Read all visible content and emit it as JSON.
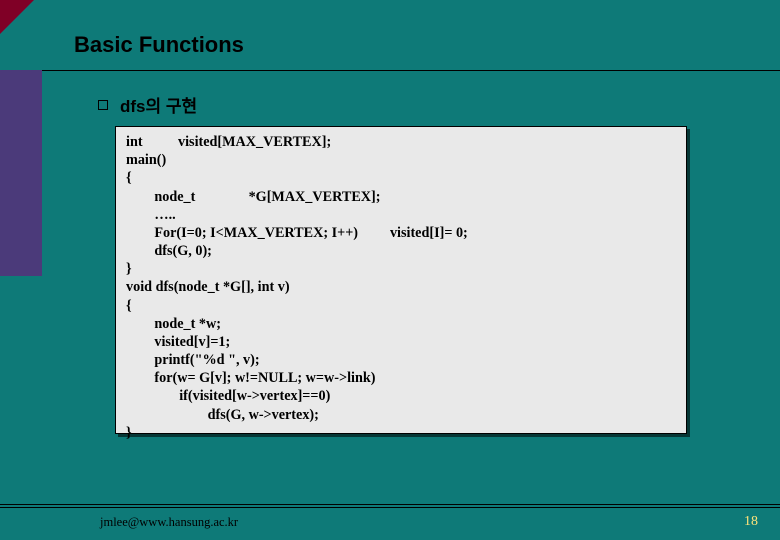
{
  "title": "Basic Functions",
  "subtitle": "dfs의 구현",
  "code_lines": [
    "int          visited[MAX_VERTEX];",
    "main()",
    "{",
    "        node_t               *G[MAX_VERTEX];",
    "        …..",
    "        For(I=0; I<MAX_VERTEX; I++)         visited[I]= 0;",
    "        dfs(G, 0);",
    "}",
    "void dfs(node_t *G[], int v)",
    "{",
    "        node_t *w;",
    "        visited[v]=1;",
    "        printf(\"%d \", v);",
    "        for(w= G[v]; w!=NULL; w=w->link)",
    "               if(visited[w->vertex]==0)",
    "                       dfs(G, w->vertex);",
    "}"
  ],
  "footer": {
    "email": "jmlee@www.hansung.ac.kr",
    "page": "18"
  }
}
